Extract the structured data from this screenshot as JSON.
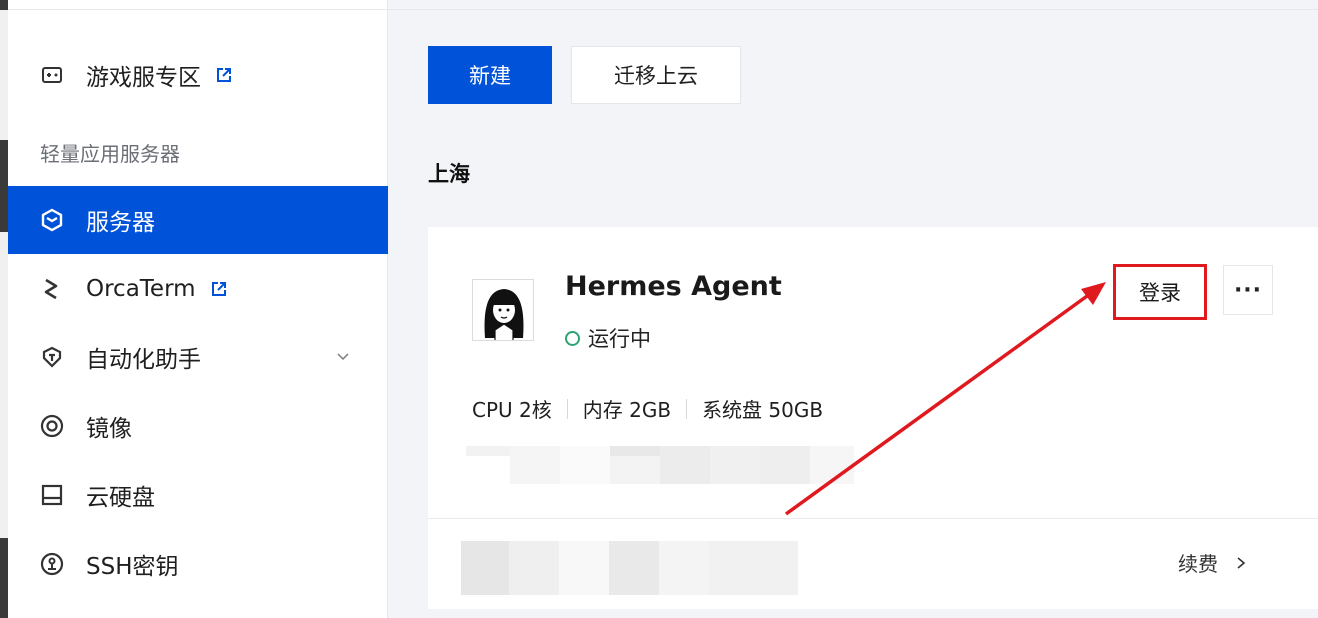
{
  "sidebar": {
    "items": [
      {
        "label": "游戏服专区",
        "icon": "gamepad-icon",
        "external": true
      },
      {
        "label": "服务器",
        "icon": "server-cube-icon",
        "active": true
      },
      {
        "label": "OrcaTerm",
        "icon": "orcaterm-icon",
        "external": true
      },
      {
        "label": "自动化助手",
        "icon": "automation-icon",
        "expandable": true
      },
      {
        "label": "镜像",
        "icon": "image-disc-icon"
      },
      {
        "label": "云硬盘",
        "icon": "cloud-disk-icon"
      },
      {
        "label": "SSH密钥",
        "icon": "ssh-key-icon"
      }
    ],
    "section_title": "轻量应用服务器"
  },
  "toolbar": {
    "new_label": "新建",
    "migrate_label": "迁移上云"
  },
  "region": "上海",
  "instance": {
    "name": "Hermes Agent",
    "status": "运行中",
    "specs": [
      "CPU 2核",
      "内存 2GB",
      "系统盘 50GB"
    ],
    "login_label": "登录",
    "more_label": "···",
    "renew_label": "续费"
  },
  "colors": {
    "accent": "#0052d9",
    "status_running": "#2ba471",
    "highlight_red": "#e0191f"
  }
}
